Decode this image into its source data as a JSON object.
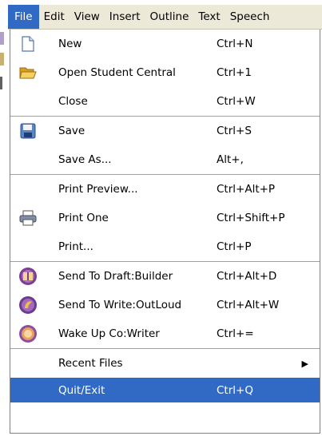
{
  "menubar": {
    "items": [
      {
        "label": "File"
      },
      {
        "label": "Edit"
      },
      {
        "label": "View"
      },
      {
        "label": "Insert"
      },
      {
        "label": "Outline"
      },
      {
        "label": "Text"
      },
      {
        "label": "Speech"
      }
    ],
    "active_color": "#316ac5"
  },
  "file_menu": {
    "new": {
      "label": "New",
      "shortcut": "Ctrl+N",
      "icon": "new-document-icon"
    },
    "open": {
      "label": "Open Student Central",
      "shortcut": "Ctrl+1",
      "icon": "open-folder-icon"
    },
    "close": {
      "label": "Close",
      "shortcut": "Ctrl+W"
    },
    "save": {
      "label": "Save",
      "shortcut": "Ctrl+S",
      "icon": "floppy-disk-icon"
    },
    "save_as": {
      "label": "Save As...",
      "shortcut": "Alt+,"
    },
    "print_preview": {
      "label": "Print Preview...",
      "shortcut": "Ctrl+Alt+P"
    },
    "print_one": {
      "label": "Print One",
      "shortcut": "Ctrl+Shift+P",
      "icon": "printer-icon"
    },
    "print": {
      "label": "Print...",
      "shortcut": "Ctrl+P"
    },
    "send_draft": {
      "label": "Send To Draft:Builder",
      "shortcut": "Ctrl+Alt+D",
      "icon": "draft-builder-icon"
    },
    "send_write": {
      "label": "Send To Write:OutLoud",
      "shortcut": "Ctrl+Alt+W",
      "icon": "write-outloud-icon"
    },
    "wake_up": {
      "label": "Wake Up Co:Writer",
      "shortcut": "Ctrl+=",
      "icon": "co-writer-icon"
    },
    "recent": {
      "label": "Recent Files",
      "icon": "submenu-arrow-icon"
    },
    "quit": {
      "label": "Quit/Exit",
      "shortcut": "Ctrl+Q"
    }
  }
}
